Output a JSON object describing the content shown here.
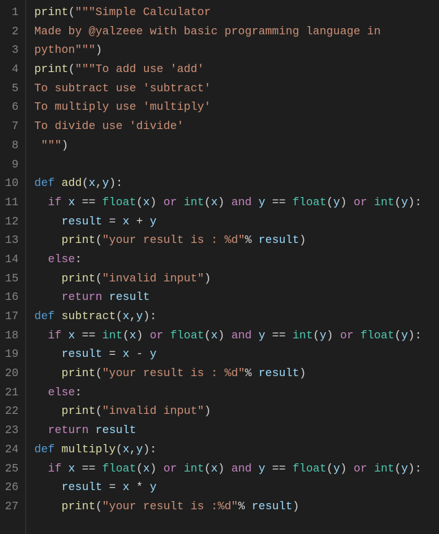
{
  "editor": {
    "lines": [
      {
        "num": "1",
        "tokens": [
          [
            "fn",
            "print"
          ],
          [
            "punc",
            "("
          ],
          [
            "str",
            "\"\"\"Simple Calculator"
          ]
        ]
      },
      {
        "num": "2",
        "tokens": [
          [
            "str",
            "Made by @yalzeee with basic programming language in python\"\"\""
          ],
          [
            "punc",
            ")"
          ]
        ]
      },
      {
        "num": "3",
        "tokens": []
      },
      {
        "num": "4",
        "tokens": [
          [
            "fn",
            "print"
          ],
          [
            "punc",
            "("
          ],
          [
            "str",
            "\"\"\"To add use 'add'"
          ]
        ]
      },
      {
        "num": "5",
        "tokens": [
          [
            "str",
            "To subtract use 'subtract'"
          ]
        ]
      },
      {
        "num": "6",
        "tokens": [
          [
            "str",
            "To multiply use 'multiply'"
          ]
        ]
      },
      {
        "num": "7",
        "tokens": [
          [
            "str",
            "To divide use 'divide'"
          ]
        ]
      },
      {
        "num": "8",
        "tokens": [
          [
            "str",
            " \"\"\""
          ],
          [
            "punc",
            ")"
          ]
        ]
      },
      {
        "num": "9",
        "tokens": []
      },
      {
        "num": "10",
        "tokens": [
          [
            "def",
            "def "
          ],
          [
            "fn",
            "add"
          ],
          [
            "punc",
            "("
          ],
          [
            "param",
            "x"
          ],
          [
            "punc",
            ","
          ],
          [
            "param",
            "y"
          ],
          [
            "punc",
            ")"
          ],
          [
            "punc",
            ":"
          ]
        ]
      },
      {
        "num": "11",
        "tokens": [
          [
            "op",
            "  "
          ],
          [
            "kw",
            "if"
          ],
          [
            "op",
            " "
          ],
          [
            "var",
            "x"
          ],
          [
            "op",
            " == "
          ],
          [
            "builtin",
            "float"
          ],
          [
            "punc",
            "("
          ],
          [
            "var",
            "x"
          ],
          [
            "punc",
            ")"
          ],
          [
            "op",
            " "
          ],
          [
            "kw",
            "or"
          ],
          [
            "op",
            " "
          ],
          [
            "builtin",
            "int"
          ],
          [
            "punc",
            "("
          ],
          [
            "var",
            "x"
          ],
          [
            "punc",
            ")"
          ],
          [
            "op",
            " "
          ],
          [
            "kw",
            "and"
          ],
          [
            "op",
            " "
          ],
          [
            "var",
            "y"
          ],
          [
            "op",
            " == "
          ],
          [
            "builtin",
            "float"
          ],
          [
            "punc",
            "("
          ],
          [
            "var",
            "y"
          ],
          [
            "punc",
            ")"
          ],
          [
            "op",
            " "
          ],
          [
            "kw",
            "or"
          ],
          [
            "op",
            " "
          ],
          [
            "builtin",
            "int"
          ],
          [
            "punc",
            "("
          ],
          [
            "var",
            "y"
          ],
          [
            "punc",
            ")"
          ],
          [
            "punc",
            ":"
          ]
        ]
      },
      {
        "num": "12",
        "tokens": [
          [
            "op",
            "    "
          ],
          [
            "var",
            "result"
          ],
          [
            "op",
            " = "
          ],
          [
            "var",
            "x"
          ],
          [
            "op",
            " + "
          ],
          [
            "var",
            "y"
          ]
        ]
      },
      {
        "num": "13",
        "tokens": [
          [
            "op",
            "    "
          ],
          [
            "fn",
            "print"
          ],
          [
            "punc",
            "("
          ],
          [
            "str",
            "\"your result is : %d\""
          ],
          [
            "op",
            "% "
          ],
          [
            "var",
            "result"
          ],
          [
            "punc",
            ")"
          ]
        ]
      },
      {
        "num": "14",
        "tokens": [
          [
            "op",
            "  "
          ],
          [
            "kw",
            "else"
          ],
          [
            "punc",
            ":"
          ]
        ]
      },
      {
        "num": "15",
        "tokens": [
          [
            "op",
            "    "
          ],
          [
            "fn",
            "print"
          ],
          [
            "punc",
            "("
          ],
          [
            "str",
            "\"invalid input\""
          ],
          [
            "punc",
            ")"
          ]
        ]
      },
      {
        "num": "16",
        "tokens": [
          [
            "op",
            "    "
          ],
          [
            "kw",
            "return"
          ],
          [
            "op",
            " "
          ],
          [
            "var",
            "result"
          ]
        ]
      },
      {
        "num": "17",
        "tokens": [
          [
            "def",
            "def "
          ],
          [
            "fn",
            "subtract"
          ],
          [
            "punc",
            "("
          ],
          [
            "param",
            "x"
          ],
          [
            "punc",
            ","
          ],
          [
            "param",
            "y"
          ],
          [
            "punc",
            ")"
          ],
          [
            "punc",
            ":"
          ]
        ]
      },
      {
        "num": "18",
        "tokens": [
          [
            "op",
            "  "
          ],
          [
            "kw",
            "if"
          ],
          [
            "op",
            " "
          ],
          [
            "var",
            "x"
          ],
          [
            "op",
            " == "
          ],
          [
            "builtin",
            "int"
          ],
          [
            "punc",
            "("
          ],
          [
            "var",
            "x"
          ],
          [
            "punc",
            ")"
          ],
          [
            "op",
            " "
          ],
          [
            "kw",
            "or"
          ],
          [
            "op",
            " "
          ],
          [
            "builtin",
            "float"
          ],
          [
            "punc",
            "("
          ],
          [
            "var",
            "x"
          ],
          [
            "punc",
            ")"
          ],
          [
            "op",
            " "
          ],
          [
            "kw",
            "and"
          ],
          [
            "op",
            " "
          ],
          [
            "var",
            "y"
          ],
          [
            "op",
            " == "
          ],
          [
            "builtin",
            "int"
          ],
          [
            "punc",
            "("
          ],
          [
            "var",
            "y"
          ],
          [
            "punc",
            ")"
          ],
          [
            "op",
            " "
          ],
          [
            "kw",
            "or"
          ],
          [
            "op",
            " "
          ],
          [
            "builtin",
            "float"
          ],
          [
            "punc",
            "("
          ],
          [
            "var",
            "y"
          ],
          [
            "punc",
            ")"
          ],
          [
            "punc",
            ":"
          ]
        ]
      },
      {
        "num": "19",
        "tokens": [
          [
            "op",
            "    "
          ],
          [
            "var",
            "result"
          ],
          [
            "op",
            " = "
          ],
          [
            "var",
            "x"
          ],
          [
            "op",
            " - "
          ],
          [
            "var",
            "y"
          ]
        ]
      },
      {
        "num": "20",
        "tokens": [
          [
            "op",
            "    "
          ],
          [
            "fn",
            "print"
          ],
          [
            "punc",
            "("
          ],
          [
            "str",
            "\"your result is : %d\""
          ],
          [
            "op",
            "% "
          ],
          [
            "var",
            "result"
          ],
          [
            "punc",
            ")"
          ]
        ]
      },
      {
        "num": "21",
        "tokens": [
          [
            "op",
            "  "
          ],
          [
            "kw",
            "else"
          ],
          [
            "punc",
            ":"
          ]
        ]
      },
      {
        "num": "22",
        "tokens": [
          [
            "op",
            "    "
          ],
          [
            "fn",
            "print"
          ],
          [
            "punc",
            "("
          ],
          [
            "str",
            "\"invalid input\""
          ],
          [
            "punc",
            ")"
          ]
        ]
      },
      {
        "num": "23",
        "tokens": [
          [
            "op",
            "  "
          ],
          [
            "kw",
            "return"
          ],
          [
            "op",
            " "
          ],
          [
            "var",
            "result"
          ]
        ]
      },
      {
        "num": "24",
        "tokens": [
          [
            "def",
            "def "
          ],
          [
            "fn",
            "multiply"
          ],
          [
            "punc",
            "("
          ],
          [
            "param",
            "x"
          ],
          [
            "punc",
            ","
          ],
          [
            "param",
            "y"
          ],
          [
            "punc",
            ")"
          ],
          [
            "punc",
            ":"
          ]
        ]
      },
      {
        "num": "25",
        "tokens": [
          [
            "op",
            "  "
          ],
          [
            "kw",
            "if"
          ],
          [
            "op",
            " "
          ],
          [
            "var",
            "x"
          ],
          [
            "op",
            " == "
          ],
          [
            "builtin",
            "float"
          ],
          [
            "punc",
            "("
          ],
          [
            "var",
            "x"
          ],
          [
            "punc",
            ")"
          ],
          [
            "op",
            " "
          ],
          [
            "kw",
            "or"
          ],
          [
            "op",
            " "
          ],
          [
            "builtin",
            "int"
          ],
          [
            "punc",
            "("
          ],
          [
            "var",
            "x"
          ],
          [
            "punc",
            ")"
          ],
          [
            "op",
            " "
          ],
          [
            "kw",
            "and"
          ],
          [
            "op",
            " "
          ],
          [
            "var",
            "y"
          ],
          [
            "op",
            " == "
          ],
          [
            "builtin",
            "float"
          ],
          [
            "punc",
            "("
          ],
          [
            "var",
            "y"
          ],
          [
            "punc",
            ")"
          ],
          [
            "op",
            " "
          ],
          [
            "kw",
            "or"
          ],
          [
            "op",
            " "
          ],
          [
            "builtin",
            "int"
          ],
          [
            "punc",
            "("
          ],
          [
            "var",
            "y"
          ],
          [
            "punc",
            ")"
          ],
          [
            "punc",
            ":"
          ]
        ]
      },
      {
        "num": "26",
        "tokens": [
          [
            "op",
            "    "
          ],
          [
            "var",
            "result"
          ],
          [
            "op",
            " = "
          ],
          [
            "var",
            "x"
          ],
          [
            "op",
            " * "
          ],
          [
            "var",
            "y"
          ]
        ]
      },
      {
        "num": "27",
        "tokens": [
          [
            "op",
            "    "
          ],
          [
            "fn",
            "print"
          ],
          [
            "punc",
            "("
          ],
          [
            "str",
            "\"your result is :%d\""
          ],
          [
            "op",
            "% "
          ],
          [
            "var",
            "result"
          ],
          [
            "punc",
            ")"
          ]
        ]
      }
    ]
  }
}
